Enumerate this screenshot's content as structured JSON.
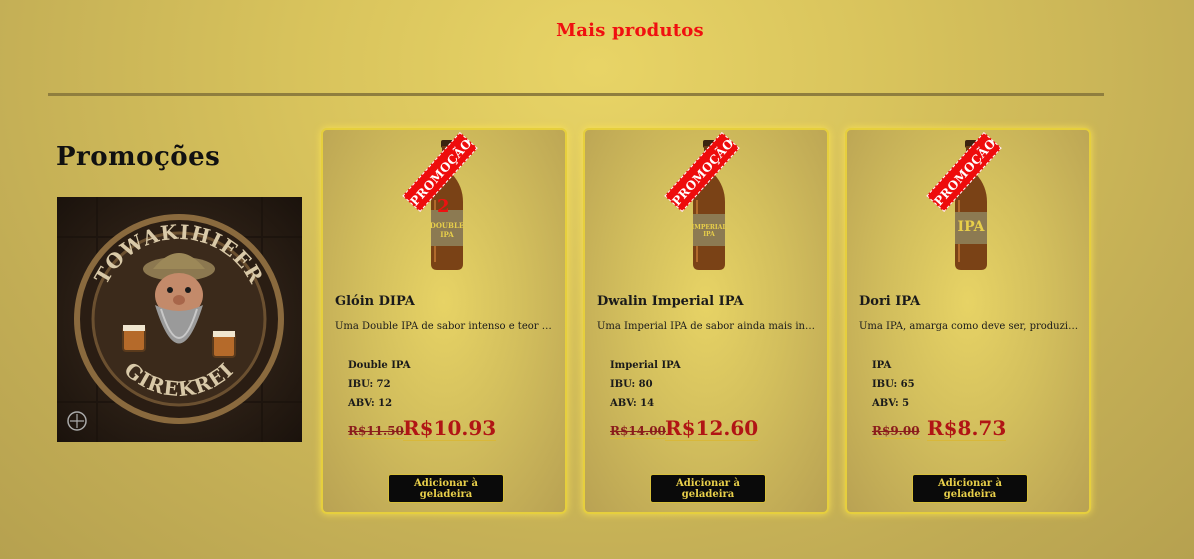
{
  "section_title": "Mais produtos",
  "promo": {
    "heading": "Promoções",
    "image_logo_text_top": "TOWAKIHIEER",
    "image_logo_text_bottom": "GIREKREI"
  },
  "colors": {
    "accent_red": "#f01010",
    "price_red": "#b11515",
    "button_bg": "#0a0a0a",
    "button_text": "#e8cf4a",
    "card_border": "#e6cf3d"
  },
  "products": [
    {
      "ribbon": "PROMOÇÃO",
      "label_text": "DOUBLE IPA",
      "label_number": "2",
      "name": "Glóin DIPA",
      "description": "Uma Double IPA de sabor intenso e teor alcoólico elevado",
      "style": "Double IPA",
      "ibu": "IBU: 72",
      "abv": "ABV: 12",
      "old_price": "R$11.50",
      "new_price": "R$10.93",
      "button": "Adicionar à geladeira"
    },
    {
      "ribbon": "PROMOÇÃO",
      "label_text": "IMPERIAL IPA",
      "label_number": "",
      "name": "Dwalin Imperial IPA",
      "description": "Uma Imperial IPA de sabor ainda mais intenso que as demais",
      "style": "Imperial IPA",
      "ibu": "IBU: 80",
      "abv": "ABV: 14",
      "old_price": "R$14.00",
      "new_price": "R$12.60",
      "button": "Adicionar à geladeira"
    },
    {
      "ribbon": "PROMOÇÃO",
      "label_text": "IPA",
      "label_number": "",
      "name": "Dori IPA",
      "description": "Uma IPA, amarga como deve ser, produzida a partir de lúpulos",
      "style": "IPA",
      "ibu": "IBU: 65",
      "abv": "ABV: 5",
      "old_price": "R$9.00",
      "new_price": "R$8.73",
      "button": "Adicionar à geladeira"
    }
  ]
}
